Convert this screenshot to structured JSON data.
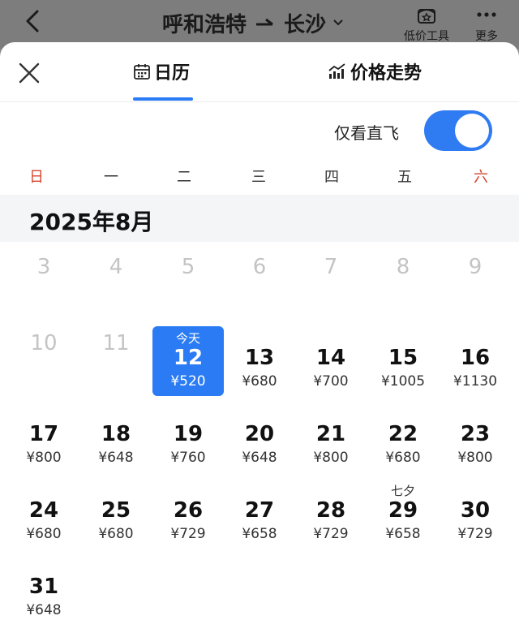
{
  "topbar": {
    "origin": "呼和浩特",
    "destination": "长沙",
    "low_price_tool_label": "低价工具",
    "more_label": "更多"
  },
  "tabs": {
    "calendar_label": "日历",
    "trend_label": "价格走势"
  },
  "direct_only": {
    "label": "仅看直飞",
    "enabled": true
  },
  "weekdays": [
    "日",
    "一",
    "二",
    "三",
    "四",
    "五",
    "六"
  ],
  "month_title": "2025年8月",
  "days": [
    {
      "day": "3",
      "price": "",
      "note": "",
      "state": "past"
    },
    {
      "day": "4",
      "price": "",
      "note": "",
      "state": "past"
    },
    {
      "day": "5",
      "price": "",
      "note": "",
      "state": "past"
    },
    {
      "day": "6",
      "price": "",
      "note": "",
      "state": "past"
    },
    {
      "day": "7",
      "price": "",
      "note": "",
      "state": "past"
    },
    {
      "day": "8",
      "price": "",
      "note": "",
      "state": "past"
    },
    {
      "day": "9",
      "price": "",
      "note": "",
      "state": "past"
    },
    {
      "day": "10",
      "price": "",
      "note": "",
      "state": "past"
    },
    {
      "day": "11",
      "price": "",
      "note": "",
      "state": "past"
    },
    {
      "day": "12",
      "price": "¥520",
      "note": "今天",
      "state": "selected"
    },
    {
      "day": "13",
      "price": "¥680",
      "note": "",
      "state": "normal"
    },
    {
      "day": "14",
      "price": "¥700",
      "note": "",
      "state": "normal"
    },
    {
      "day": "15",
      "price": "¥1005",
      "note": "",
      "state": "normal"
    },
    {
      "day": "16",
      "price": "¥1130",
      "note": "",
      "state": "normal"
    },
    {
      "day": "17",
      "price": "¥800",
      "note": "",
      "state": "normal"
    },
    {
      "day": "18",
      "price": "¥648",
      "note": "",
      "state": "normal"
    },
    {
      "day": "19",
      "price": "¥760",
      "note": "",
      "state": "normal"
    },
    {
      "day": "20",
      "price": "¥648",
      "note": "",
      "state": "normal"
    },
    {
      "day": "21",
      "price": "¥800",
      "note": "",
      "state": "normal"
    },
    {
      "day": "22",
      "price": "¥680",
      "note": "",
      "state": "normal"
    },
    {
      "day": "23",
      "price": "¥800",
      "note": "",
      "state": "normal"
    },
    {
      "day": "24",
      "price": "¥680",
      "note": "",
      "state": "normal"
    },
    {
      "day": "25",
      "price": "¥680",
      "note": "",
      "state": "normal"
    },
    {
      "day": "26",
      "price": "¥729",
      "note": "",
      "state": "normal"
    },
    {
      "day": "27",
      "price": "¥658",
      "note": "",
      "state": "normal"
    },
    {
      "day": "28",
      "price": "¥729",
      "note": "",
      "state": "normal"
    },
    {
      "day": "29",
      "price": "¥658",
      "note": "七夕",
      "state": "normal"
    },
    {
      "day": "30",
      "price": "¥729",
      "note": "",
      "state": "normal"
    },
    {
      "day": "31",
      "price": "¥648",
      "note": "",
      "state": "normal"
    }
  ],
  "colors": {
    "accent": "#2b7cf4",
    "weekend": "#d6452d",
    "past_day": "#c4c4c4"
  }
}
